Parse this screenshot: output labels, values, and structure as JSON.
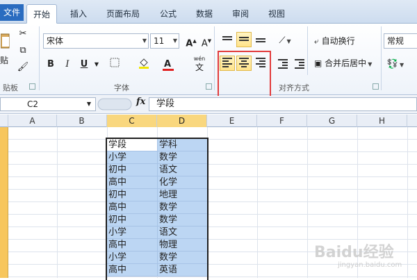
{
  "tabs": [
    {
      "label": "文件"
    },
    {
      "label": "开始"
    },
    {
      "label": "插入"
    },
    {
      "label": "页面布局"
    },
    {
      "label": "公式"
    },
    {
      "label": "数据"
    },
    {
      "label": "审阅"
    },
    {
      "label": "视图"
    }
  ],
  "ribbon": {
    "paste_label": "贴",
    "clipboard_label": "贴板",
    "font_name": "宋体",
    "font_size": "11",
    "font_group_label": "字体",
    "wen_label": "wén",
    "wen_char": "文",
    "wrap_text_label": "自动换行",
    "merge_center_label": "合并后居中",
    "align_group_label": "对齐方式",
    "number_format": "常规"
  },
  "formula_bar": {
    "cell_ref": "C2",
    "fx": "fx",
    "value": "学段"
  },
  "columns": [
    "A",
    "B",
    "C",
    "D",
    "E",
    "F",
    "G",
    "H"
  ],
  "selected_columns": [
    "C",
    "D"
  ],
  "rows": [
    {
      "c": "学段",
      "d": "学科"
    },
    {
      "c": "小学",
      "d": "数学"
    },
    {
      "c": "初中",
      "d": "语文"
    },
    {
      "c": "高中",
      "d": "化学"
    },
    {
      "c": "初中",
      "d": "地理"
    },
    {
      "c": "高中",
      "d": "数学"
    },
    {
      "c": "初中",
      "d": "数学"
    },
    {
      "c": "小学",
      "d": "语文"
    },
    {
      "c": "高中",
      "d": "物理"
    },
    {
      "c": "小学",
      "d": "数学"
    },
    {
      "c": "高中",
      "d": "英语"
    }
  ],
  "watermark": {
    "main": "Baidu经验",
    "sub": "jingyan.baidu.com"
  },
  "colors": {
    "selection": "#bcd6f3",
    "highlight_box": "#e23b3b",
    "active_tab_bg": "#ffffff",
    "file_tab": "#2a6cc0"
  }
}
